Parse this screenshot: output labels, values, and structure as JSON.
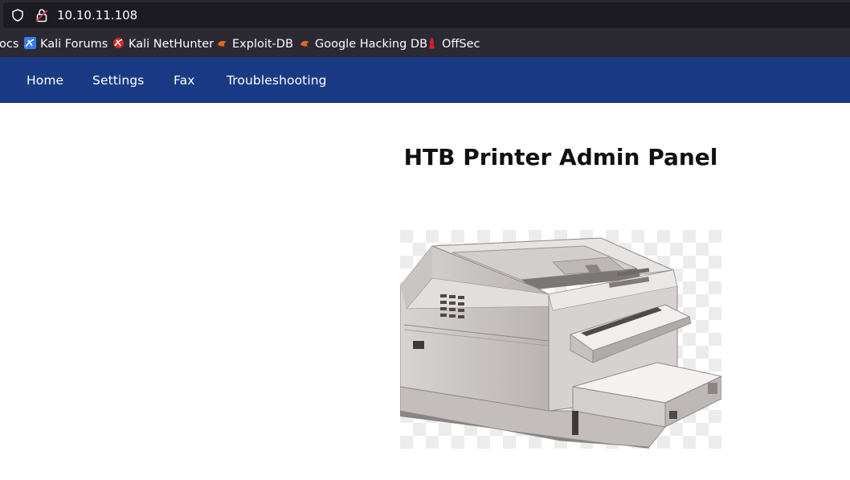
{
  "browser": {
    "url": "10.10.11.108",
    "bookmarks": [
      {
        "label": "ocs",
        "icon": "none"
      },
      {
        "label": "Kali Forums",
        "icon": "kali-forums-icon"
      },
      {
        "label": "Kali NetHunter",
        "icon": "kali-nethunter-icon"
      },
      {
        "label": "Exploit-DB",
        "icon": "exploit-db-icon"
      },
      {
        "label": "Google Hacking DB",
        "icon": "google-hacking-db-icon"
      },
      {
        "label": "OffSec",
        "icon": "offsec-icon"
      }
    ]
  },
  "nav": {
    "items": [
      "Home",
      "Settings",
      "Fax",
      "Troubleshooting"
    ],
    "background": "#1a3a86"
  },
  "main": {
    "title": "HTB Printer Admin Panel",
    "image": "printer-image"
  }
}
